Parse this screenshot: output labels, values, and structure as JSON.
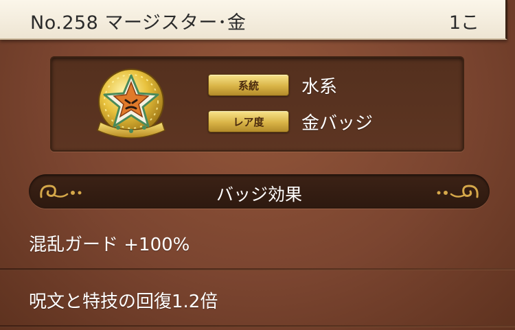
{
  "header": {
    "title": "No.258  マージスター･金",
    "count": "1こ"
  },
  "info": {
    "badge_icon": "gold-starfish-monster-badge-icon",
    "rows": [
      {
        "tag": "系統",
        "value": "水系"
      },
      {
        "tag": "レア度",
        "value": "金バッジ"
      }
    ]
  },
  "effects": {
    "heading": "バッジ効果",
    "items": [
      "混乱ガード +100%",
      "呪文と特技の回復1.2倍"
    ]
  },
  "colors": {
    "header_bg": "#f4eddd",
    "panel_bg": "#7b4530",
    "tag_gold": "#d9b447",
    "band_bg": "#341d12",
    "text_white": "#ffffff"
  }
}
